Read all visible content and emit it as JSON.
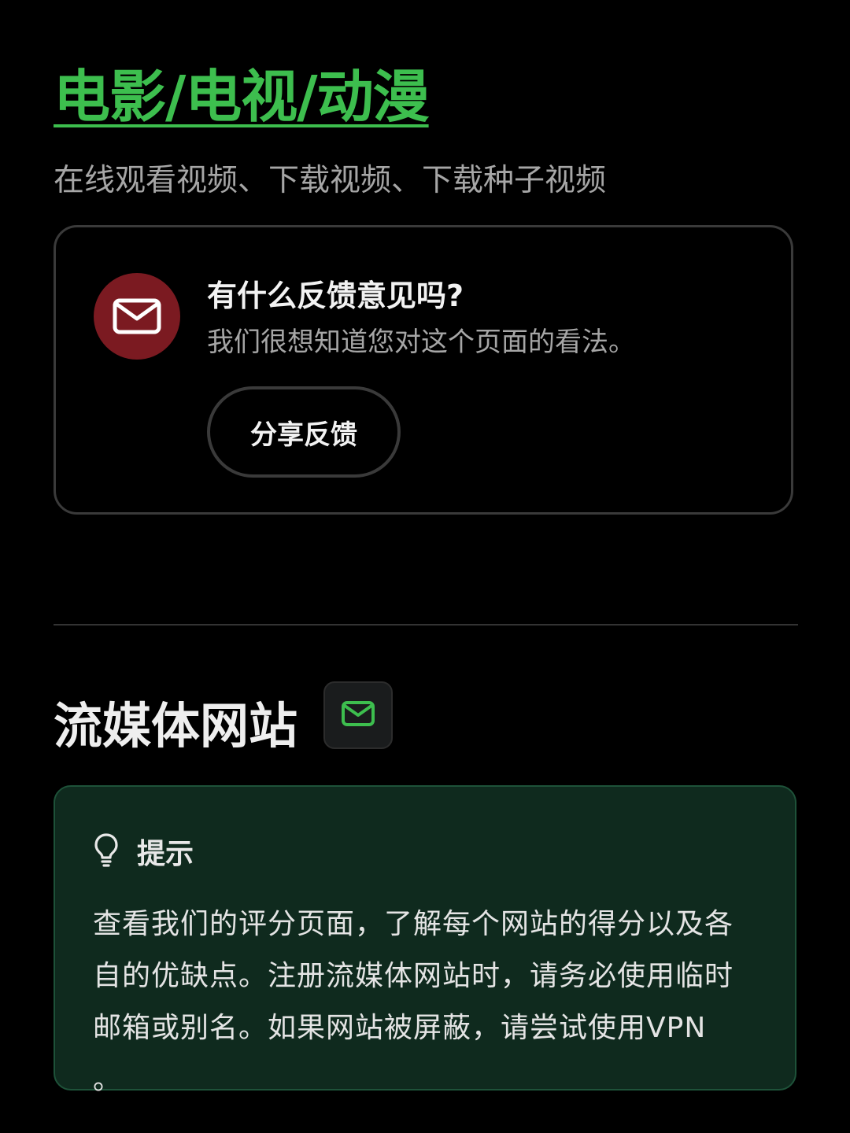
{
  "header": {
    "title": "电影/电视/动漫",
    "subtitle": "在线观看视频、下载视频、下载种子视频"
  },
  "feedback": {
    "icon": "mail-icon",
    "title": "有什么反馈意见吗?",
    "description": "我们很想知道您对这个页面的看法。",
    "button_label": "分享反馈"
  },
  "section": {
    "title": "流媒体网站",
    "icon": "mail-icon"
  },
  "tip": {
    "icon": "lightbulb-icon",
    "label": "提示",
    "body": "查看我们的评分页面，了解每个网站的得分以及各自的优缺点。注册流媒体网站时，请务必使用临时邮箱或别名。如果网站被屏蔽，请尝试使用VPN 。"
  },
  "colors": {
    "accent_green": "#3dbe4e",
    "mail_circle": "#7b1a21",
    "tip_background": "#0f2a1e"
  }
}
